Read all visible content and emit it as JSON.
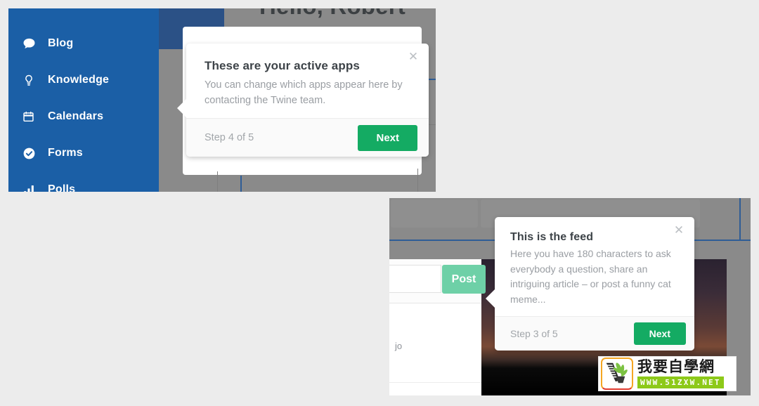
{
  "page": {
    "background_color": "#ececec"
  },
  "top_screenshot": {
    "header_greeting": "Hello, Robert",
    "sidebar": {
      "background_color": "#1b5fa6",
      "items": [
        {
          "label": "Blog",
          "icon": "chat-bubble-icon"
        },
        {
          "label": "Knowledge",
          "icon": "lightbulb-icon"
        },
        {
          "label": "Calendars",
          "icon": "calendar-icon"
        },
        {
          "label": "Forms",
          "icon": "check-circle-icon"
        },
        {
          "label": "Polls",
          "icon": "bar-chart-icon"
        }
      ]
    },
    "tooltip": {
      "title": "These are your active apps",
      "body": "You can change which apps appear here by contacting the Twine team.",
      "step": "Step 4 of 5",
      "next_label": "Next",
      "close_icon": "close-icon",
      "next_color": "#14ab63"
    }
  },
  "bottom_screenshot": {
    "composer": {
      "post_label": "Post",
      "post_color": "#6ed0a7"
    },
    "feed_text_fragment": "jo",
    "tooltip": {
      "title": "This is the feed",
      "body": "Here you have 180 characters to ask everybody a question, share an intriguing article – or post a funny cat meme...",
      "step": "Step 3 of 5",
      "next_label": "Next",
      "close_icon": "close-icon",
      "next_color": "#14ab63"
    }
  },
  "watermark": {
    "chinese_text": "我要自學網",
    "url_text": "WWW.51ZXW.NET",
    "url_bar_color": "#8dc919"
  }
}
